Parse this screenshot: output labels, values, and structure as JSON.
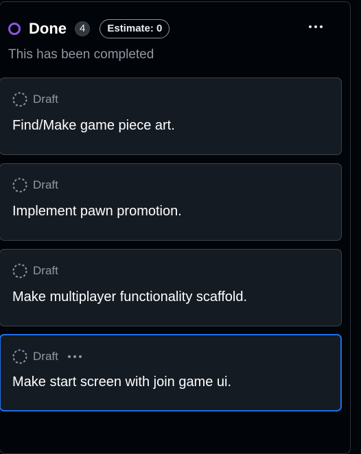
{
  "column": {
    "title": "Done",
    "count": "4",
    "estimate": "Estimate: 0",
    "description": "This has been completed",
    "menu_icon": "kebab-horizontal-icon",
    "status_color": "#8957e5"
  },
  "cards": [
    {
      "type": "Draft",
      "title": "Find/Make game piece art."
    },
    {
      "type": "Draft",
      "title": "Implement pawn promotion."
    },
    {
      "type": "Draft",
      "title": "Make multiplayer functionality scaffold."
    },
    {
      "type": "Draft",
      "title": "Make start screen with join game ui.",
      "selected": true
    }
  ],
  "colors": {
    "background": "#010409",
    "card": "#151b23",
    "selected_border": "#1f6feb"
  }
}
